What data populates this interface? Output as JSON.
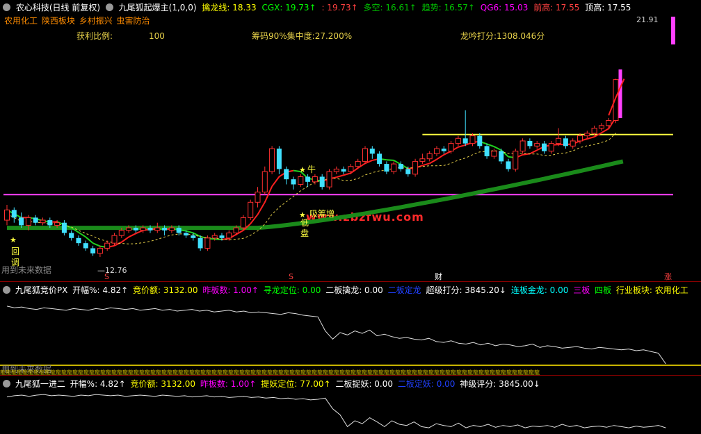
{
  "main": {
    "header": [
      {
        "text": "农心科技(日线 前复权)",
        "color": "#ffffff"
      },
      {
        "text": "九尾狐起爆主(1,0,0)",
        "color": "#ffffff"
      },
      {
        "text": "擒龙线: 18.33",
        "color": "#ffff00"
      },
      {
        "text": "CGX: 19.73↑",
        "color": "#00ff00"
      },
      {
        "text": ": 19.73↑",
        "color": "#ff4040"
      },
      {
        "text": "多空: 16.61↑",
        "color": "#00c000"
      },
      {
        "text": "趋势: 16.57↑",
        "color": "#00c000"
      },
      {
        "text": "QG6: 15.03",
        "color": "#ff00ff"
      },
      {
        "text": "前高: 17.55",
        "color": "#ff4040"
      },
      {
        "text": "顶高: 17.55",
        "color": "#ffffff"
      }
    ],
    "tags": [
      {
        "text": "农用化工",
        "color": "#ff8c00"
      },
      {
        "text": "陕西板块",
        "color": "#ff8c00"
      },
      {
        "text": "乡村振兴",
        "color": "#ff8c00"
      },
      {
        "text": "虫害防治",
        "color": "#ff8c00"
      }
    ],
    "info": {
      "ratio_label": "获利比例:",
      "ratio_value": "100",
      "chip": "筹码90%集中度:27.200%",
      "score": "龙吟打分:1308.046分"
    },
    "price_high": "21.91",
    "price_low": "12.76",
    "future_text": "用到未来数据",
    "watermark": "www.zbzfwu.com",
    "labels": {
      "huitiao1": "回",
      "huitiao2": "调",
      "niu": "牛",
      "dixi1": "低",
      "dixi2": "吸",
      "pan": "盘",
      "buy": "吸筹增"
    },
    "axis_marks": [
      {
        "text": "S",
        "color": "#ff4040"
      },
      {
        "text": "S",
        "color": "#ff4040"
      },
      {
        "text": "财",
        "color": "#ffffff"
      },
      {
        "text": "涨",
        "color": "#ff4040"
      }
    ]
  },
  "sub1": {
    "header": [
      {
        "text": "九尾狐竞价PX",
        "color": "#ffffff"
      },
      {
        "text": "开幅%: 4.82↑",
        "color": "#ffffff"
      },
      {
        "text": "竞价额: 3132.00",
        "color": "#ffff00"
      },
      {
        "text": "昨板数: 1.00↑",
        "color": "#ff00ff"
      },
      {
        "text": "寻龙定位: 0.00",
        "color": "#00ff00"
      },
      {
        "text": "二板擒龙: 0.00",
        "color": "#ffffff"
      },
      {
        "text": "二板定龙",
        "color": "#2040ff"
      },
      {
        "text": "超级打分: 3845.20↓",
        "color": "#ffffff"
      },
      {
        "text": "连板金龙: 0.00",
        "color": "#00ffff"
      },
      {
        "text": "三板",
        "color": "#ff00ff"
      },
      {
        "text": "四板",
        "color": "#00ff00"
      },
      {
        "text": "行业板块: 农用化工",
        "color": "#ffff00"
      }
    ],
    "future_text": "用到未来数据",
    "band_text": "龍龍龍龍龍龍龍龍龍龍龍龍龍龍龍龍龍龍龍龍龍龍龍龍龍龍龍龍龍龍龍龍龍龍龍龍龍龍龍龍龍龍龍龍龍龍龍龍龍龍龍龍龍龍龍龍龍龍龍龍龍龍龍龍龍龍龍龍龍龍龍龍龍龍龍龍龍龍龍龍龍龍龍龍龍龍龍龍龍龍龍龍龍龍龍龍龍"
  },
  "sub2": {
    "header": [
      {
        "text": "九尾狐一进二",
        "color": "#ffffff"
      },
      {
        "text": "开幅%: 4.82↑",
        "color": "#ffffff"
      },
      {
        "text": "竞价额: 3132.00",
        "color": "#ffff00"
      },
      {
        "text": "昨板数: 1.00↑",
        "color": "#ff00ff"
      },
      {
        "text": "提妖定位: 77.00↑",
        "color": "#ffff00"
      },
      {
        "text": "二板捉妖: 0.00",
        "color": "#ffffff"
      },
      {
        "text": "二板定妖: 0.00",
        "color": "#2040ff"
      },
      {
        "text": "神级评分: 3845.00↓",
        "color": "#ffffff"
      }
    ]
  },
  "chart_data": {
    "type": "candlestick",
    "candles": [
      {
        "o": 14.2,
        "c": 14.6,
        "h": 14.8,
        "l": 14.0
      },
      {
        "o": 14.6,
        "c": 14.3,
        "h": 14.7,
        "l": 14.1
      },
      {
        "o": 14.3,
        "c": 14.0,
        "h": 14.5,
        "l": 13.9
      },
      {
        "o": 14.0,
        "c": 14.3,
        "h": 14.4,
        "l": 13.8
      },
      {
        "o": 14.3,
        "c": 14.1,
        "h": 14.4,
        "l": 14.0
      },
      {
        "o": 14.1,
        "c": 14.2,
        "h": 14.3,
        "l": 14.0
      },
      {
        "o": 14.2,
        "c": 14.0,
        "h": 14.3,
        "l": 13.9
      },
      {
        "o": 14.0,
        "c": 14.1,
        "h": 14.2,
        "l": 13.9
      },
      {
        "o": 14.1,
        "c": 13.7,
        "h": 14.2,
        "l": 13.6
      },
      {
        "o": 13.7,
        "c": 13.5,
        "h": 13.8,
        "l": 13.4
      },
      {
        "o": 13.5,
        "c": 13.3,
        "h": 13.6,
        "l": 13.2
      },
      {
        "o": 13.3,
        "c": 13.1,
        "h": 13.4,
        "l": 13.0
      },
      {
        "o": 13.1,
        "c": 12.9,
        "h": 13.2,
        "l": 12.8
      },
      {
        "o": 12.9,
        "c": 13.1,
        "h": 13.2,
        "l": 12.76
      },
      {
        "o": 13.1,
        "c": 13.3,
        "h": 13.4,
        "l": 13.0
      },
      {
        "o": 13.3,
        "c": 13.6,
        "h": 13.7,
        "l": 13.2
      },
      {
        "o": 13.6,
        "c": 13.8,
        "h": 13.9,
        "l": 13.5
      },
      {
        "o": 13.8,
        "c": 13.9,
        "h": 14.0,
        "l": 13.7
      },
      {
        "o": 13.9,
        "c": 13.8,
        "h": 14.0,
        "l": 13.7
      },
      {
        "o": 13.8,
        "c": 13.9,
        "h": 14.0,
        "l": 13.7
      },
      {
        "o": 13.9,
        "c": 13.8,
        "h": 14.0,
        "l": 13.7
      },
      {
        "o": 13.8,
        "c": 13.9,
        "h": 14.1,
        "l": 13.7
      },
      {
        "o": 13.9,
        "c": 13.8,
        "h": 14.0,
        "l": 13.6
      },
      {
        "o": 13.8,
        "c": 13.9,
        "h": 14.0,
        "l": 13.7
      },
      {
        "o": 13.9,
        "c": 13.7,
        "h": 14.0,
        "l": 13.6
      },
      {
        "o": 13.7,
        "c": 13.6,
        "h": 13.8,
        "l": 13.5
      },
      {
        "o": 13.6,
        "c": 13.5,
        "h": 13.7,
        "l": 13.4
      },
      {
        "o": 13.5,
        "c": 13.1,
        "h": 13.6,
        "l": 13.0
      },
      {
        "o": 13.1,
        "c": 13.5,
        "h": 13.6,
        "l": 13.0
      },
      {
        "o": 13.5,
        "c": 13.6,
        "h": 13.7,
        "l": 13.4
      },
      {
        "o": 13.6,
        "c": 13.5,
        "h": 13.7,
        "l": 13.4
      },
      {
        "o": 13.5,
        "c": 13.7,
        "h": 13.8,
        "l": 13.4
      },
      {
        "o": 13.7,
        "c": 13.9,
        "h": 14.0,
        "l": 13.6
      },
      {
        "o": 13.9,
        "c": 14.3,
        "h": 14.4,
        "l": 13.8
      },
      {
        "o": 14.3,
        "c": 14.9,
        "h": 15.0,
        "l": 14.2
      },
      {
        "o": 14.9,
        "c": 15.3,
        "h": 15.5,
        "l": 14.7
      },
      {
        "o": 15.3,
        "c": 16.1,
        "h": 16.3,
        "l": 15.2
      },
      {
        "o": 16.1,
        "c": 17.0,
        "h": 17.1,
        "l": 16.0
      },
      {
        "o": 17.0,
        "c": 16.2,
        "h": 17.1,
        "l": 16.0
      },
      {
        "o": 16.2,
        "c": 15.8,
        "h": 16.3,
        "l": 15.6
      },
      {
        "o": 15.8,
        "c": 15.6,
        "h": 15.9,
        "l": 15.4
      },
      {
        "o": 15.6,
        "c": 15.9,
        "h": 16.0,
        "l": 15.5
      },
      {
        "o": 15.9,
        "c": 15.7,
        "h": 16.0,
        "l": 15.5
      },
      {
        "o": 15.7,
        "c": 15.9,
        "h": 16.0,
        "l": 15.6
      },
      {
        "o": 15.9,
        "c": 15.5,
        "h": 16.0,
        "l": 15.4
      },
      {
        "o": 15.5,
        "c": 16.1,
        "h": 16.2,
        "l": 15.4
      },
      {
        "o": 16.1,
        "c": 16.2,
        "h": 16.3,
        "l": 16.0
      },
      {
        "o": 16.2,
        "c": 16.1,
        "h": 16.3,
        "l": 16.0
      },
      {
        "o": 16.1,
        "c": 16.3,
        "h": 16.4,
        "l": 16.0
      },
      {
        "o": 16.3,
        "c": 16.5,
        "h": 16.6,
        "l": 16.2
      },
      {
        "o": 16.5,
        "c": 17.0,
        "h": 17.1,
        "l": 16.4
      },
      {
        "o": 17.0,
        "c": 16.8,
        "h": 17.1,
        "l": 16.6
      },
      {
        "o": 16.8,
        "c": 16.4,
        "h": 16.9,
        "l": 16.3
      },
      {
        "o": 16.4,
        "c": 16.1,
        "h": 16.5,
        "l": 16.0
      },
      {
        "o": 16.1,
        "c": 16.4,
        "h": 16.5,
        "l": 16.0
      },
      {
        "o": 16.4,
        "c": 16.2,
        "h": 16.5,
        "l": 16.1
      },
      {
        "o": 16.2,
        "c": 16.0,
        "h": 16.3,
        "l": 15.9
      },
      {
        "o": 16.0,
        "c": 16.5,
        "h": 16.6,
        "l": 15.9
      },
      {
        "o": 16.5,
        "c": 16.6,
        "h": 16.8,
        "l": 16.4
      },
      {
        "o": 16.6,
        "c": 16.8,
        "h": 16.9,
        "l": 16.5
      },
      {
        "o": 16.8,
        "c": 17.0,
        "h": 17.1,
        "l": 16.7
      },
      {
        "o": 17.0,
        "c": 16.9,
        "h": 17.1,
        "l": 16.8
      },
      {
        "o": 16.9,
        "c": 17.2,
        "h": 17.3,
        "l": 16.8
      },
      {
        "o": 17.2,
        "c": 17.4,
        "h": 17.5,
        "l": 17.1
      },
      {
        "o": 17.4,
        "c": 17.2,
        "h": 18.5,
        "l": 17.1
      },
      {
        "o": 17.2,
        "c": 17.5,
        "h": 17.6,
        "l": 17.1
      },
      {
        "o": 17.5,
        "c": 17.1,
        "h": 17.6,
        "l": 17.0
      },
      {
        "o": 17.1,
        "c": 16.7,
        "h": 17.2,
        "l": 16.6
      },
      {
        "o": 16.7,
        "c": 16.9,
        "h": 17.0,
        "l": 16.6
      },
      {
        "o": 16.9,
        "c": 16.5,
        "h": 17.0,
        "l": 16.4
      },
      {
        "o": 16.5,
        "c": 16.2,
        "h": 16.6,
        "l": 16.1
      },
      {
        "o": 16.2,
        "c": 16.9,
        "h": 17.0,
        "l": 16.1
      },
      {
        "o": 16.9,
        "c": 17.3,
        "h": 17.4,
        "l": 16.8
      },
      {
        "o": 17.3,
        "c": 17.1,
        "h": 17.4,
        "l": 17.0
      },
      {
        "o": 17.1,
        "c": 17.2,
        "h": 17.3,
        "l": 17.0
      },
      {
        "o": 17.2,
        "c": 16.9,
        "h": 17.3,
        "l": 16.8
      },
      {
        "o": 16.9,
        "c": 17.2,
        "h": 17.3,
        "l": 16.8
      },
      {
        "o": 17.2,
        "c": 17.4,
        "h": 17.8,
        "l": 17.1
      },
      {
        "o": 17.4,
        "c": 17.1,
        "h": 17.5,
        "l": 17.0
      },
      {
        "o": 17.1,
        "c": 17.3,
        "h": 17.4,
        "l": 17.0
      },
      {
        "o": 17.3,
        "c": 17.5,
        "h": 17.6,
        "l": 17.2
      },
      {
        "o": 17.5,
        "c": 17.6,
        "h": 17.7,
        "l": 17.4
      },
      {
        "o": 17.6,
        "c": 17.8,
        "h": 17.9,
        "l": 17.5
      },
      {
        "o": 17.8,
        "c": 17.9,
        "h": 18.0,
        "l": 17.7
      },
      {
        "o": 17.9,
        "c": 18.1,
        "h": 18.2,
        "l": 17.8
      },
      {
        "o": 18.1,
        "c": 19.7,
        "h": 19.73,
        "l": 18.0
      }
    ],
    "ma_slow_start": 13.9,
    "ma_slow_end": 16.5,
    "hline_magenta": 15.2,
    "hline_yellow": 17.55,
    "ylim": [
      12.0,
      22.0
    ],
    "sub1_series": [
      60,
      58,
      59,
      57,
      56,
      58,
      57,
      56,
      55,
      57,
      56,
      55,
      57,
      56,
      58,
      57,
      56,
      57,
      55,
      56,
      57,
      55,
      56,
      54,
      55,
      56,
      54,
      55,
      53,
      54,
      55,
      53,
      54,
      52,
      53,
      52,
      51,
      50,
      52,
      51,
      49,
      48,
      47,
      30,
      20,
      28,
      25,
      30,
      27,
      31,
      24,
      26,
      23,
      21,
      22,
      20,
      19,
      21,
      17,
      16,
      18,
      15,
      14,
      16,
      13,
      15,
      12,
      14,
      13,
      11,
      12,
      14,
      10,
      12,
      11,
      9,
      10,
      11,
      9,
      8,
      10,
      9,
      8,
      7,
      8,
      6,
      7,
      5,
      3,
      -10
    ],
    "sub2_series": [
      60,
      62,
      63,
      61,
      63,
      64,
      62,
      63,
      62,
      61,
      63,
      62,
      64,
      63,
      62,
      63,
      61,
      62,
      63,
      62,
      61,
      63,
      62,
      61,
      62,
      60,
      61,
      62,
      60,
      61,
      59,
      60,
      61,
      59,
      60,
      58,
      59,
      57,
      58,
      56,
      57,
      55,
      56,
      58,
      40,
      30,
      10,
      20,
      15,
      25,
      18,
      10,
      20,
      14,
      12,
      18,
      10,
      8,
      15,
      12,
      10,
      16,
      8,
      12,
      10,
      14,
      9,
      12,
      10,
      13,
      8,
      11,
      10,
      12,
      9,
      14,
      10,
      12,
      8,
      10,
      11,
      9,
      12,
      10,
      8,
      11,
      9,
      10,
      12,
      8
    ]
  }
}
